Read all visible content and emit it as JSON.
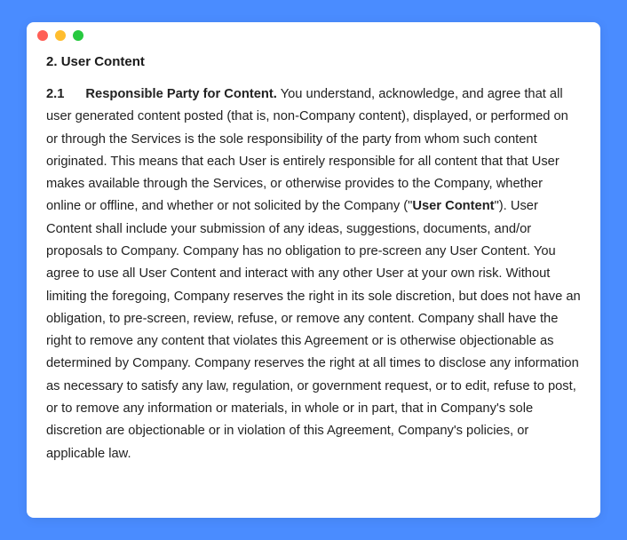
{
  "section": {
    "number": "2.",
    "title": "User Content"
  },
  "clause": {
    "number": "2.1",
    "title": "Responsible Party for Content.",
    "body_pre": "  You understand, acknowledge, and agree that all user generated content posted (that is, non-Company content), displayed, or performed on or through the Services is the sole responsibility of the party from whom such content originated.  This means that each User is entirely responsible for all content that that User makes available through the Services, or otherwise provides to the Company, whether online or offline, and whether or not solicited by the Company (\"",
    "defined_term": "User Content",
    "body_post": "\").  User Content shall include your submission of any ideas, suggestions, documents, and/or proposals to Company.  Company has no obligation to pre-screen any User Content.  You agree to use all User Content and interact with any other User at your own risk.  Without limiting the foregoing, Company reserves the right in its sole discretion, but does not have an obligation, to pre-screen, review, refuse, or remove any content.  Company shall have the right to remove any content that violates this Agreement or is otherwise objectionable as determined by Company.  Company reserves the right at all times to disclose any information as necessary to satisfy any law, regulation, or government request, or to edit, refuse to post, or to remove any information or materials, in whole or in part, that in Company's sole discretion are objectionable or in violation of this Agreement, Company's policies, or applicable law."
  }
}
